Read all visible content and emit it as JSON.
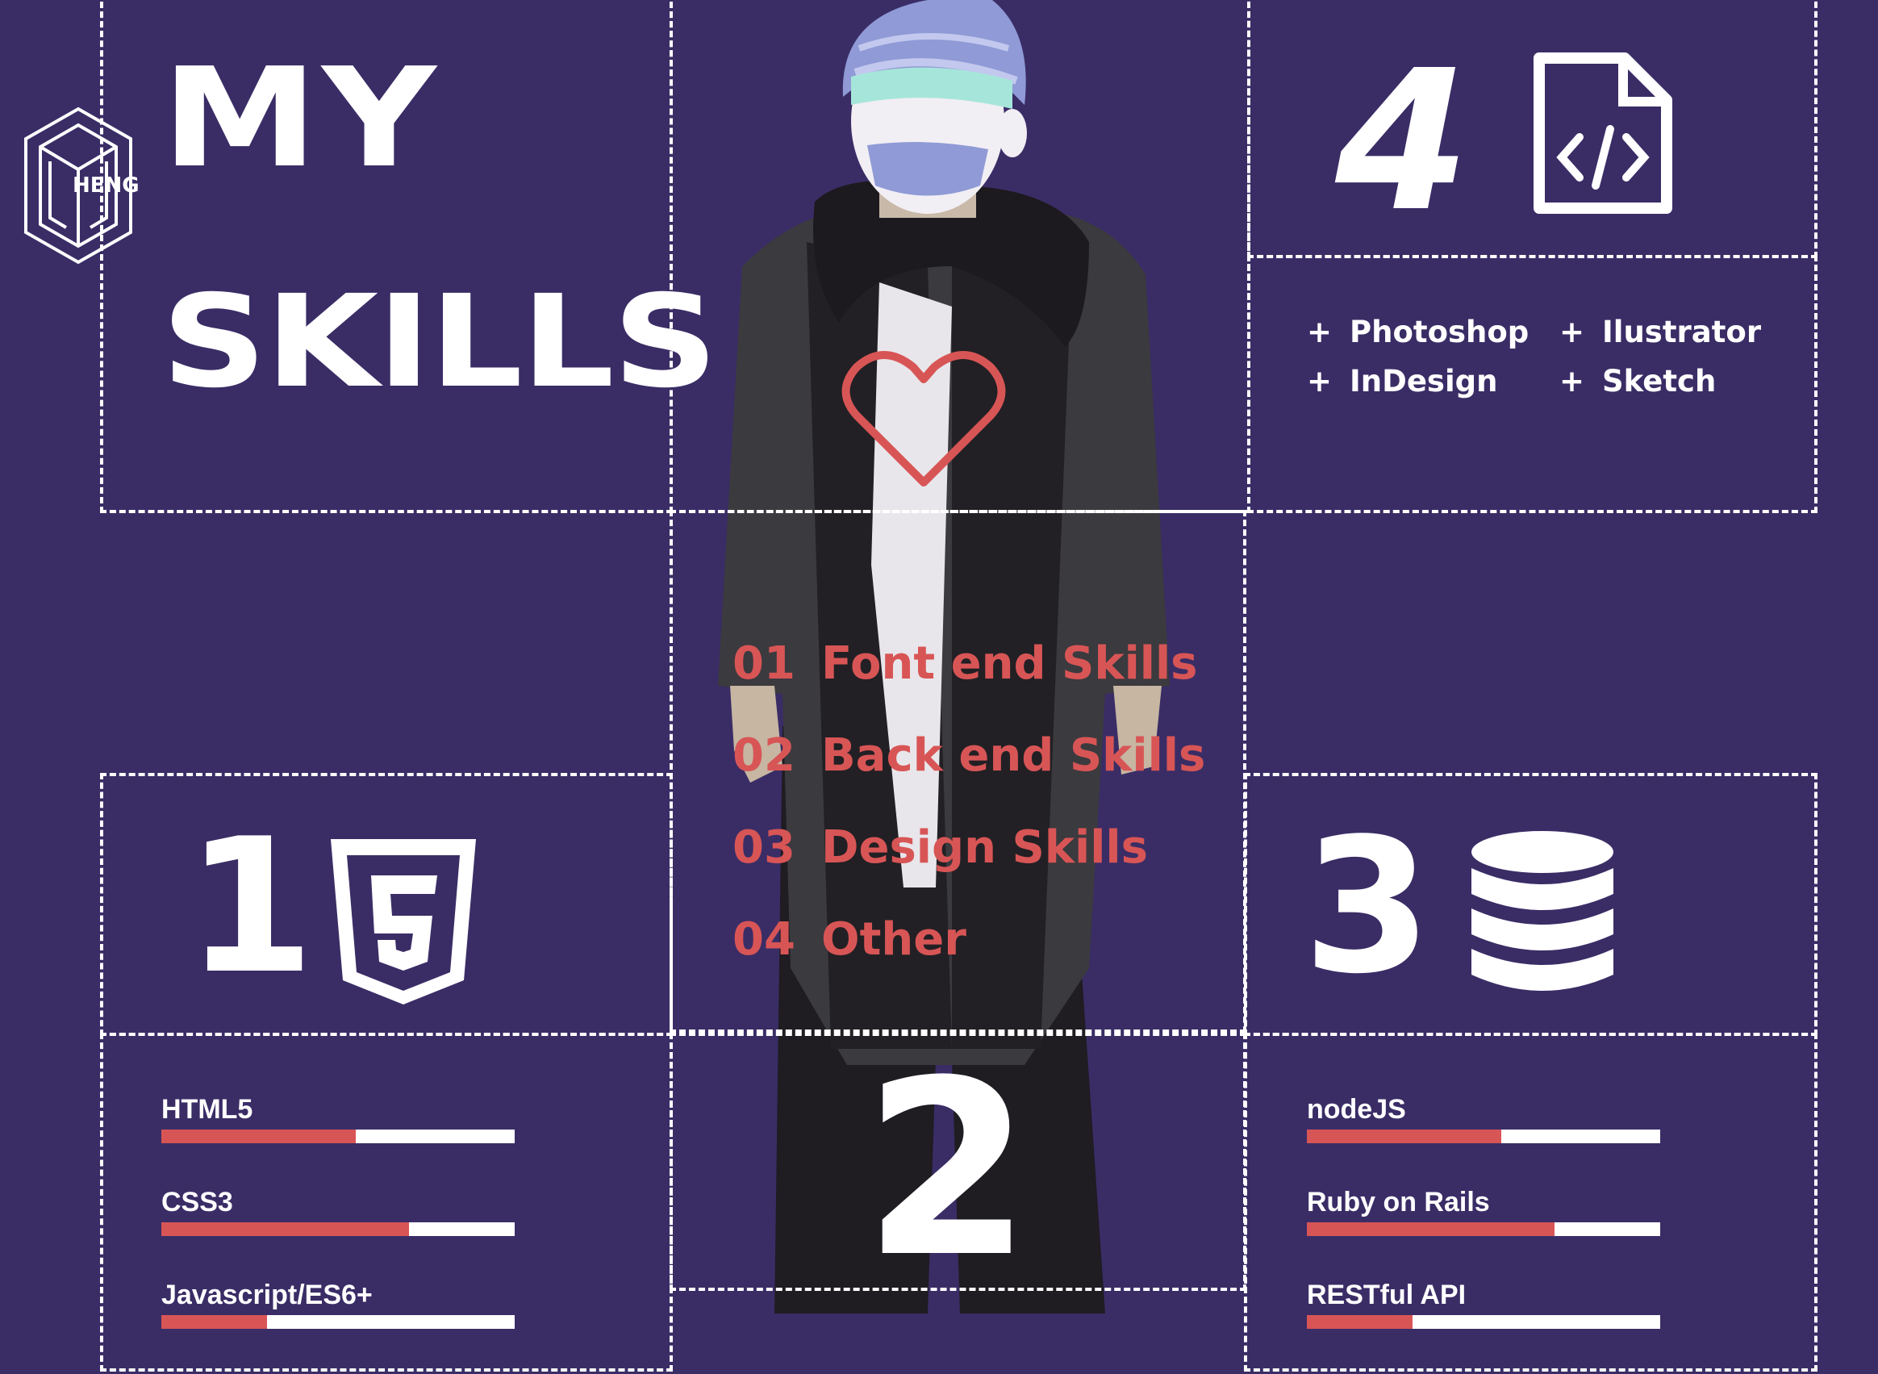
{
  "header": {
    "title_line1": "MY",
    "title_line2": "SKILLS",
    "logo_text": "HENG"
  },
  "sections": {
    "front_end": {
      "number": "1",
      "icon": "html5-icon"
    },
    "back_end": {
      "number": "3",
      "icon": "database-icon"
    },
    "design": {
      "number": "4",
      "icon": "code-file-icon"
    },
    "other": {
      "number": "2"
    }
  },
  "center": {
    "icon": "heart-icon"
  },
  "menu": [
    {
      "num": "01",
      "label": "Font end Skills"
    },
    {
      "num": "02",
      "label": "Back end Skills"
    },
    {
      "num": "03",
      "label": "Design Skills"
    },
    {
      "num": "04",
      "label": "Other"
    }
  ],
  "design_skills": [
    "Photoshop",
    "Ilustrator",
    "InDesign",
    "Sketch"
  ],
  "design_plus": "+",
  "front_end_skills": [
    {
      "name": "HTML5",
      "level": 0.55
    },
    {
      "name": "CSS3",
      "level": 0.7
    },
    {
      "name": "Javascript/ES6+",
      "level": 0.3
    }
  ],
  "back_end_skills": [
    {
      "name": "nodeJS",
      "level": 0.55
    },
    {
      "name": "Ruby on Rails",
      "level": 0.7
    },
    {
      "name": "RESTful API",
      "level": 0.3
    }
  ],
  "colors": {
    "background": "#3a2d66",
    "accent": "#d85556",
    "text": "#ffffff"
  }
}
